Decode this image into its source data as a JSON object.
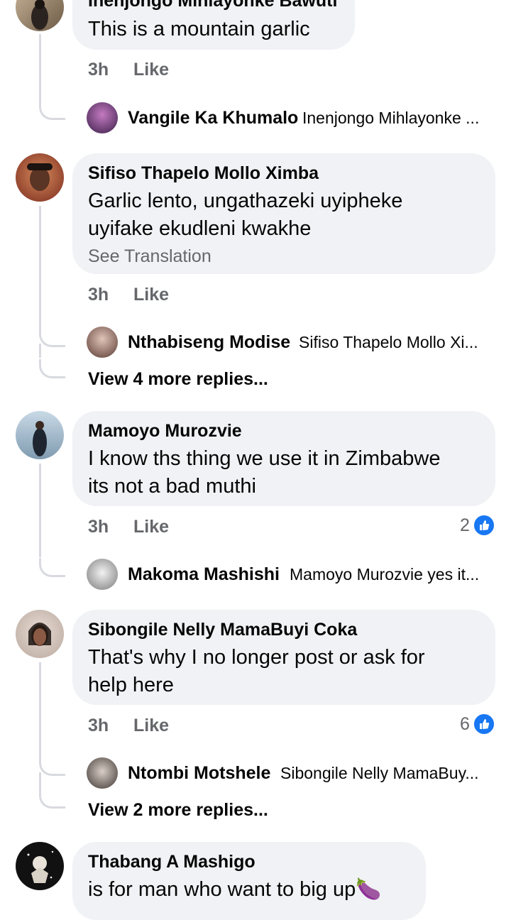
{
  "comments": [
    {
      "author": "Inenjongo Mihlayonke Bawuti",
      "lines": [
        "This is a mountain garlic"
      ],
      "time": "3h",
      "like": "Like",
      "reply": {
        "name": "Vangile Ka Khumalo",
        "preview": "Inenjongo Mihlayonke ..."
      }
    },
    {
      "author": "Sifiso Thapelo Mollo Ximba",
      "lines": [
        "Garlic lento, ungathazeki uyipheke",
        "uyifake ekudleni kwakhe"
      ],
      "see_translation": "See Translation",
      "time": "3h",
      "like": "Like",
      "reply": {
        "name": "Nthabiseng Modise",
        "preview": "Sifiso Thapelo Mollo Xi..."
      },
      "view_more": "View 4 more replies..."
    },
    {
      "author": "Mamoyo Murozvie",
      "lines": [
        "I know ths thing we  use it in Zimbabwe",
        "its not a bad muthi"
      ],
      "time": "3h",
      "like": "Like",
      "reactions": "2",
      "reply": {
        "name": "Makoma Mashishi",
        "preview": "Mamoyo Murozvie yes it..."
      }
    },
    {
      "author": "Sibongile Nelly MamaBuyi Coka",
      "lines": [
        "That's why I no longer post or ask for",
        "help here"
      ],
      "time": "3h",
      "like": "Like",
      "reactions": "6",
      "reply": {
        "name": "Ntombi Motshele",
        "preview": "Sibongile Nelly MamaBuy..."
      },
      "view_more": "View 2 more replies..."
    },
    {
      "author": "Thabang A Mashigo",
      "lines": [
        "is for man who want to big up"
      ],
      "emoji": "🍆"
    }
  ],
  "colors": {
    "bubble": "#f0f2f5",
    "meta_text": "#65676b",
    "like_blue": "#1877f2",
    "thread_line": "#d8dadf"
  },
  "icons": {
    "like_badge": "thumbs-up-icon"
  }
}
